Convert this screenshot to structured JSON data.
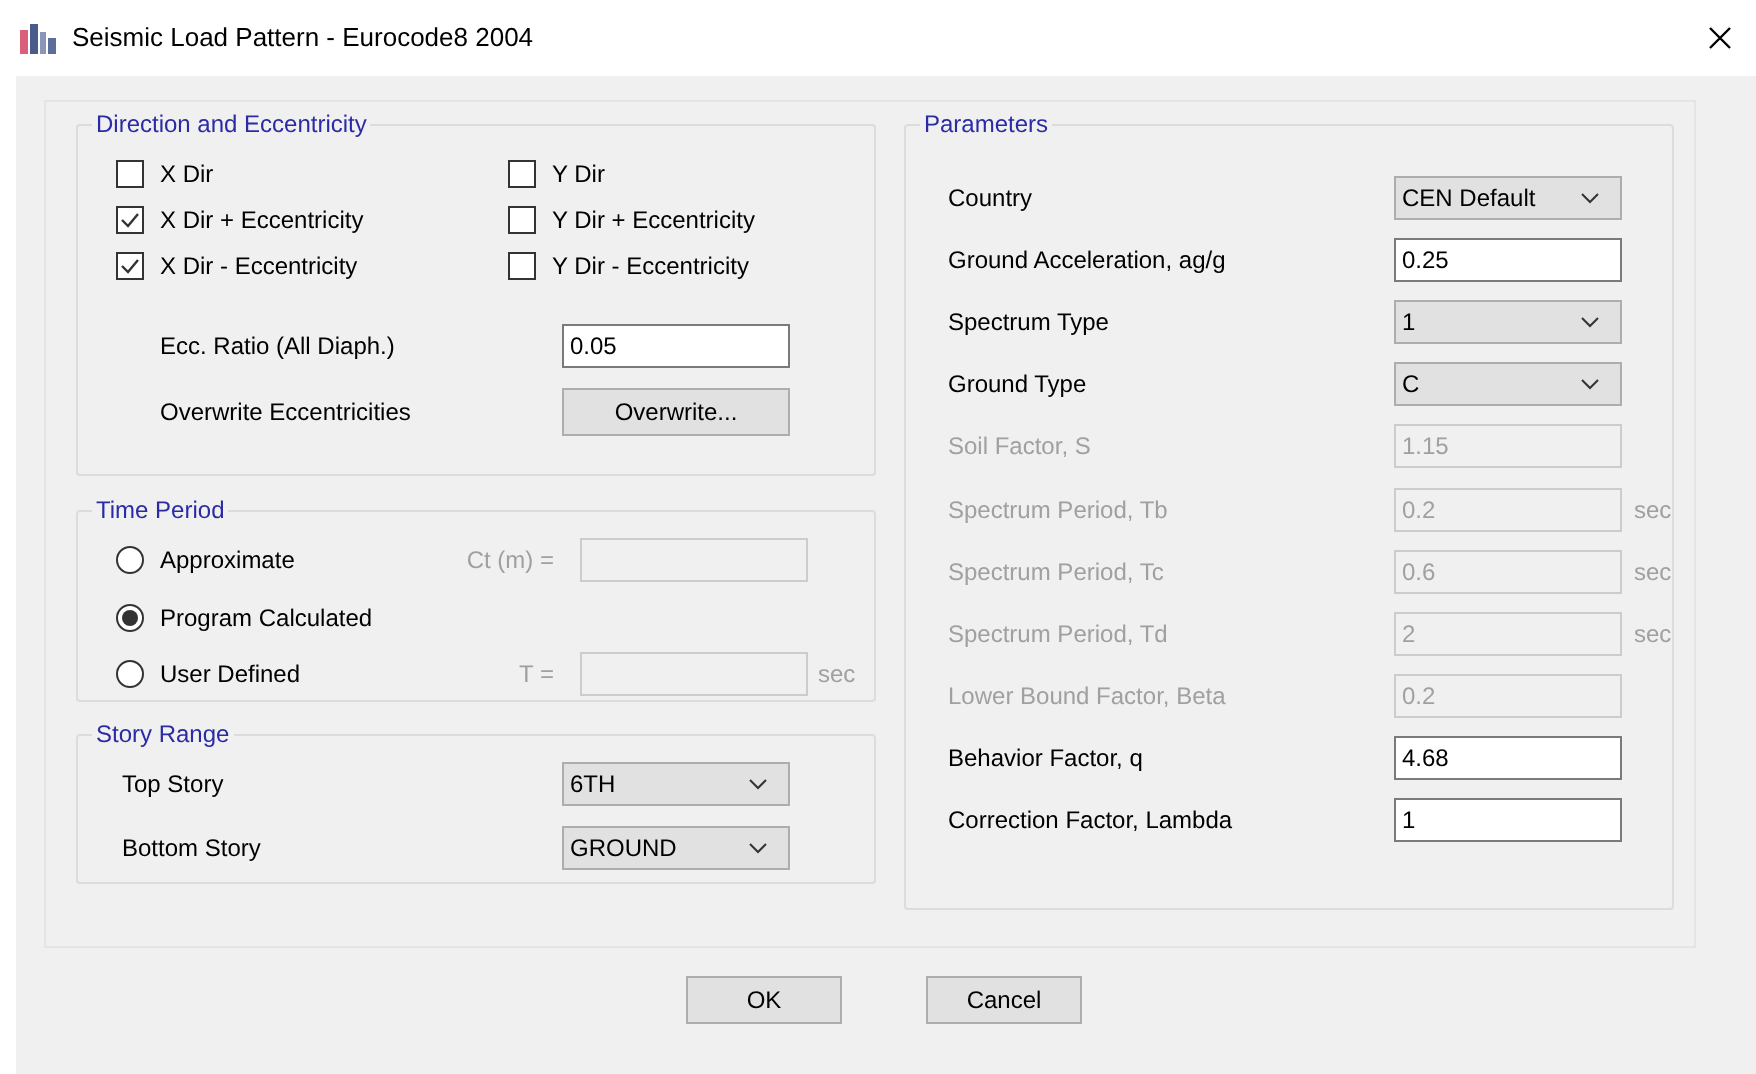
{
  "window": {
    "title": "Seismic Load Pattern - Eurocode8 2004"
  },
  "direction_and_eccentricity": {
    "title": "Direction and Eccentricity",
    "checkboxes": [
      {
        "label": "X Dir",
        "checked": false
      },
      {
        "label": "Y Dir",
        "checked": false
      },
      {
        "label": "X Dir + Eccentricity",
        "checked": true
      },
      {
        "label": "Y Dir + Eccentricity",
        "checked": false
      },
      {
        "label": "X Dir - Eccentricity",
        "checked": true
      },
      {
        "label": "Y Dir - Eccentricity",
        "checked": false
      }
    ],
    "ecc_ratio": {
      "label": "Ecc. Ratio (All Diaph.)",
      "value": "0.05"
    },
    "overwrite": {
      "label": "Overwrite Eccentricities",
      "button": "Overwrite..."
    }
  },
  "time_period": {
    "title": "Time Period",
    "options": [
      {
        "label": "Approximate",
        "selected": false,
        "field_label": "Ct (m) ="
      },
      {
        "label": "Program Calculated",
        "selected": true
      },
      {
        "label": "User Defined",
        "selected": false,
        "field_label": "T =",
        "unit": "sec"
      }
    ]
  },
  "story_range": {
    "title": "Story Range",
    "rows": [
      {
        "label": "Top Story",
        "value": "6TH"
      },
      {
        "label": "Bottom Story",
        "value": "GROUND"
      }
    ]
  },
  "parameters": {
    "title": "Parameters",
    "rows": [
      {
        "label": "Country",
        "kind": "dropdown",
        "value": "CEN Default"
      },
      {
        "label": "Ground Acceleration, ag/g",
        "kind": "input",
        "value": "0.25",
        "disabled": false
      },
      {
        "label": "Spectrum Type",
        "kind": "dropdown",
        "value": "1"
      },
      {
        "label": "Ground Type",
        "kind": "dropdown",
        "value": "C"
      },
      {
        "label": "Soil Factor, S",
        "kind": "input",
        "value": "1.15",
        "disabled": true
      },
      {
        "label": "Spectrum Period, Tb",
        "kind": "input",
        "value": "0.2",
        "disabled": true,
        "unit": "sec"
      },
      {
        "label": "Spectrum Period, Tc",
        "kind": "input",
        "value": "0.6",
        "disabled": true,
        "unit": "sec"
      },
      {
        "label": "Spectrum Period, Td",
        "kind": "input",
        "value": "2",
        "disabled": true,
        "unit": "sec"
      },
      {
        "label": "Lower Bound Factor, Beta",
        "kind": "input",
        "value": "0.2",
        "disabled": true
      },
      {
        "label": "Behavior Factor, q",
        "kind": "input",
        "value": "4.68",
        "disabled": false
      },
      {
        "label": "Correction Factor, Lambda",
        "kind": "input",
        "value": "1",
        "disabled": false
      }
    ]
  },
  "buttons": [
    "OK",
    "Cancel"
  ]
}
